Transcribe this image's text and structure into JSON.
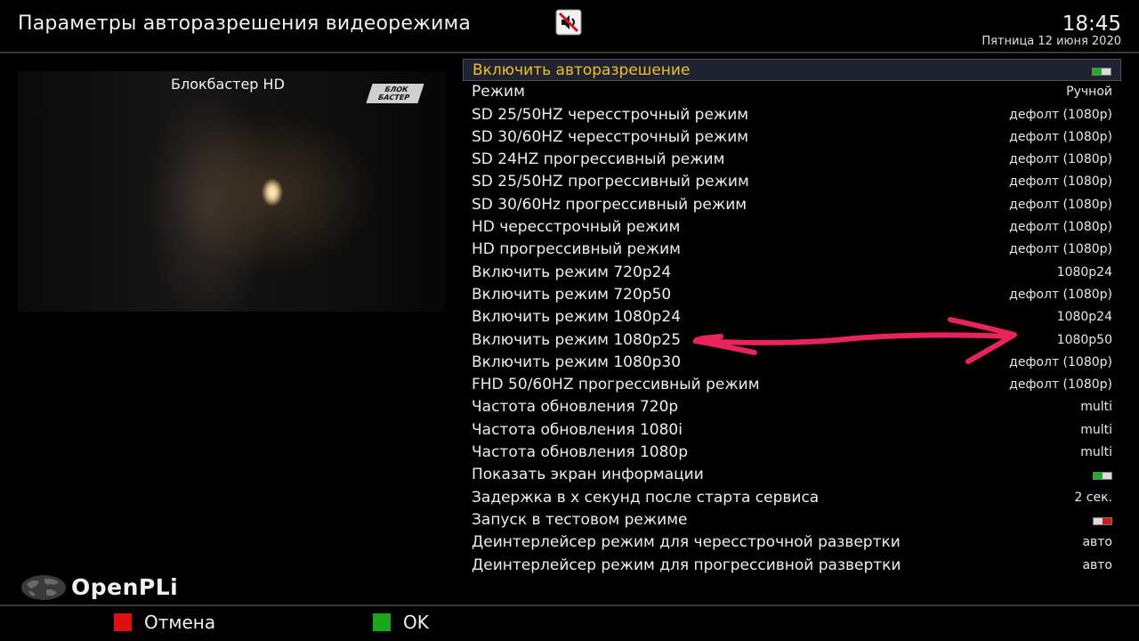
{
  "header": {
    "title": "Параметры авторазрешения видеорежима",
    "time": "18:45",
    "date": "Пятница 12 июня 2020",
    "status_icon": "mute-icon"
  },
  "preview": {
    "channel_name": "Блокбастер HD",
    "channel_logo_line1": "БЛОК",
    "channel_logo_line2": "БАСТЕР"
  },
  "menu": {
    "items": [
      {
        "label": "Включить авторазрешение",
        "toggle": "on",
        "selected": true
      },
      {
        "label": "Режим",
        "value": "Ручной"
      },
      {
        "label": "SD 25/50HZ чересстрочный режим",
        "value": "дефолт (1080p)"
      },
      {
        "label": "SD 30/60HZ чересстрочный режим",
        "value": "дефолт (1080p)"
      },
      {
        "label": "SD 24HZ прогрессивный режим",
        "value": "дефолт (1080p)"
      },
      {
        "label": "SD 25/50HZ прогрессивный режим",
        "value": "дефолт (1080p)"
      },
      {
        "label": "SD 30/60Hz прогрессивный режим",
        "value": "дефолт (1080p)"
      },
      {
        "label": "HD чересстрочный режим",
        "value": "дефолт (1080p)"
      },
      {
        "label": "HD прогрессивный режим",
        "value": "дефолт (1080p)"
      },
      {
        "label": "Включить режим 720p24",
        "value": "1080p24"
      },
      {
        "label": "Включить режим 720p50",
        "value": "дефолт (1080p)"
      },
      {
        "label": "Включить режим 1080p24",
        "value": "1080p24"
      },
      {
        "label": "Включить режим 1080p25",
        "value": "1080p50"
      },
      {
        "label": "Включить режим 1080p30",
        "value": "дефолт (1080p)"
      },
      {
        "label": "FHD 50/60HZ прогрессивный режим",
        "value": "дефолт (1080p)"
      },
      {
        "label": "Частота обновления 720p",
        "value": "multi"
      },
      {
        "label": "Частота обновления 1080i",
        "value": "multi"
      },
      {
        "label": "Частота обновления 1080p",
        "value": "multi"
      },
      {
        "label": "Показать экран информации",
        "toggle": "on"
      },
      {
        "label": "Задержка в x секунд после старта сервиса",
        "value": "2 сек."
      },
      {
        "label": "Запуск в тестовом режиме",
        "toggle": "off"
      },
      {
        "label": "Деинтерлейсер режим для чересстрочной развертки",
        "value": "авто"
      },
      {
        "label": "Деинтерлейсер режим для прогрессивной развертки",
        "value": "авто"
      }
    ]
  },
  "branding": {
    "name": "OpenPLi",
    "icon": "globe-icon"
  },
  "footer": {
    "cancel_label": "Отмена",
    "ok_label": "OK",
    "cancel_color": "#e01010",
    "ok_color": "#18a818"
  },
  "colors": {
    "selected_text": "#f0c020",
    "toggle_on": "#1fae2a",
    "toggle_off": "#d01818",
    "annotation": "#e8245a"
  }
}
